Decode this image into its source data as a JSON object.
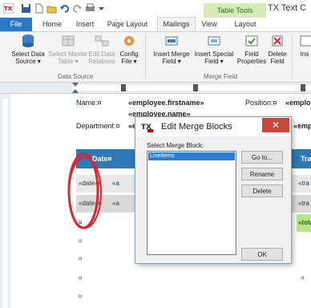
{
  "app": {
    "title": "TX Text C",
    "table_tools": "Table Tools"
  },
  "qat": {
    "icons": [
      "save-icon",
      "new-icon",
      "open-icon",
      "undo-icon",
      "redo-icon",
      "print-icon",
      "dropdown-icon"
    ]
  },
  "tabs": [
    "File",
    "Home",
    "Insert",
    "Page Layout",
    "Mailings",
    "View",
    "Layout"
  ],
  "ribbon": {
    "data_source": [
      {
        "line1": "Select Data",
        "line2": "Source ▾",
        "enabled": true
      },
      {
        "line1": "Select Master",
        "line2": "Table ▾",
        "enabled": false
      },
      {
        "line1": "Edit Data",
        "line2": "Relations",
        "enabled": false
      },
      {
        "line1": "Config",
        "line2": "File ▾",
        "enabled": true
      }
    ],
    "merge_field": [
      {
        "line1": "Insert Merge",
        "line2": "Field ▾"
      },
      {
        "line1": "Insert Special",
        "line2": "Field ▾"
      },
      {
        "line1": "Field",
        "line2": "Properties"
      },
      {
        "line1": "Delete",
        "line2": "Field"
      },
      {
        "line1": "Ins",
        "line2": ""
      }
    ],
    "group_data_source": "Data Source",
    "group_merge_field": "Merge Field"
  },
  "document": {
    "name_label": "Name:¤",
    "firstname": "«employee.firstname»",
    "position_label": "Position:¤",
    "position_value": "«emplo",
    "lastname": "«employee.name»",
    "department_label": "Department:¤",
    "department_value": "«e",
    "department_right": "«emplo",
    "table_header": {
      "date": "Date¤",
      "right": "Tra"
    },
    "row1": {
      "c1": "«date»¤",
      "c2": "«a",
      "c3": "«tra"
    },
    "row2": {
      "c1": "«date»¤",
      "c2": "«a",
      "c3": "«tra"
    },
    "row3": {
      "c1": "¤",
      "c3": "«tota"
    },
    "para_marks": [
      "¤",
      "¤",
      "¤",
      "¤",
      "¤"
    ]
  },
  "dialog": {
    "title": "Edit Merge Blocks",
    "label": "Select Merge Block:",
    "items": [
      "LineItems"
    ],
    "buttons": {
      "goto": "Go to...",
      "rename": "Rename",
      "delete": "Delete",
      "ok": "OK"
    },
    "close": "✕"
  },
  "colors": {
    "accent": "#2b79c4",
    "table_header": "#2e78b8",
    "annotation": "#e0222b",
    "table_tools": "#d6ecb8"
  }
}
